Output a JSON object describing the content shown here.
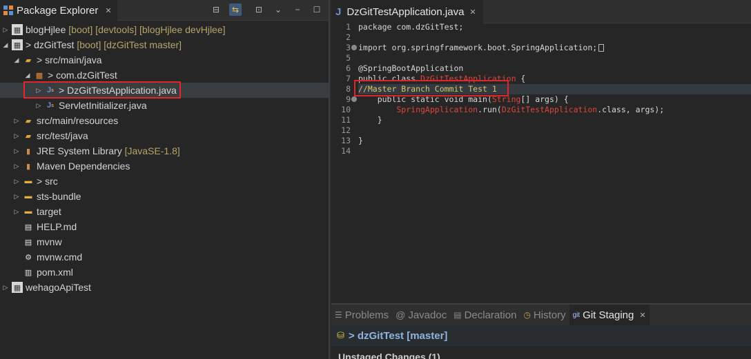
{
  "package_explorer": {
    "title": "Package Explorer",
    "tree": [
      {
        "label": "blogHjlee",
        "decoration": "[boot] [devtools] [blogHjlee devHjlee]",
        "prefix": ""
      },
      {
        "label": "dzGitTest",
        "decoration": "[boot] [dzGitTest master]",
        "prefix": "> "
      },
      {
        "label": "src/main/java",
        "decoration": "",
        "prefix": "> "
      },
      {
        "label": "com.dzGitTest",
        "decoration": "",
        "prefix": "> "
      },
      {
        "label": "DzGitTestApplication.java",
        "decoration": "",
        "prefix": "> "
      },
      {
        "label": "ServletInitializer.java",
        "decoration": "",
        "prefix": ""
      },
      {
        "label": "src/main/resources",
        "decoration": "",
        "prefix": ""
      },
      {
        "label": "src/test/java",
        "decoration": "",
        "prefix": ""
      },
      {
        "label": "JRE System Library",
        "decoration": "[JavaSE-1.8]",
        "prefix": ""
      },
      {
        "label": "Maven Dependencies",
        "decoration": "",
        "prefix": ""
      },
      {
        "label": "src",
        "decoration": "",
        "prefix": "> "
      },
      {
        "label": "sts-bundle",
        "decoration": "",
        "prefix": ""
      },
      {
        "label": "target",
        "decoration": "",
        "prefix": ""
      },
      {
        "label": "HELP.md",
        "decoration": "",
        "prefix": ""
      },
      {
        "label": "mvnw",
        "decoration": "",
        "prefix": ""
      },
      {
        "label": "mvnw.cmd",
        "decoration": "",
        "prefix": ""
      },
      {
        "label": "pom.xml",
        "decoration": "",
        "prefix": ""
      },
      {
        "label": "wehagoApiTest",
        "decoration": "",
        "prefix": ""
      }
    ]
  },
  "editor": {
    "tab_title": "DzGitTestApplication.java",
    "line_numbers": [
      "1",
      "2",
      "3",
      "5",
      "6",
      "7",
      "8",
      "9",
      "10",
      "11",
      "12",
      "13",
      "14"
    ],
    "code": {
      "l1_kw": "package",
      "l1_rest": " com.dzGitTest;",
      "l3_kw": "import",
      "l3_rest": " org.springframework.boot.SpringApplication;",
      "l6": "@SpringBootApplication",
      "l7_kw": "public class ",
      "l7_cls": "DzGitTestApplication",
      "l7_rest": " {",
      "l8": "//Master Branch Commit Test 1",
      "l9_kw": "    public static void ",
      "l9_name": "main(",
      "l9_type": "String",
      "l9_rest": "[] args) {",
      "l10_cls": "        SpringApplication",
      "l10_a": ".run(",
      "l10_cls2": "DzGitTestApplication",
      "l10_b": ".class, args);",
      "l11": "    }",
      "l13": "}"
    }
  },
  "bottom_views": {
    "tabs": [
      "Problems",
      "Javadoc",
      "Declaration",
      "History",
      "Git Staging"
    ],
    "staging_title": "> dzGitTest [master]",
    "unstaged_label": "Unstaged Changes (1)"
  }
}
